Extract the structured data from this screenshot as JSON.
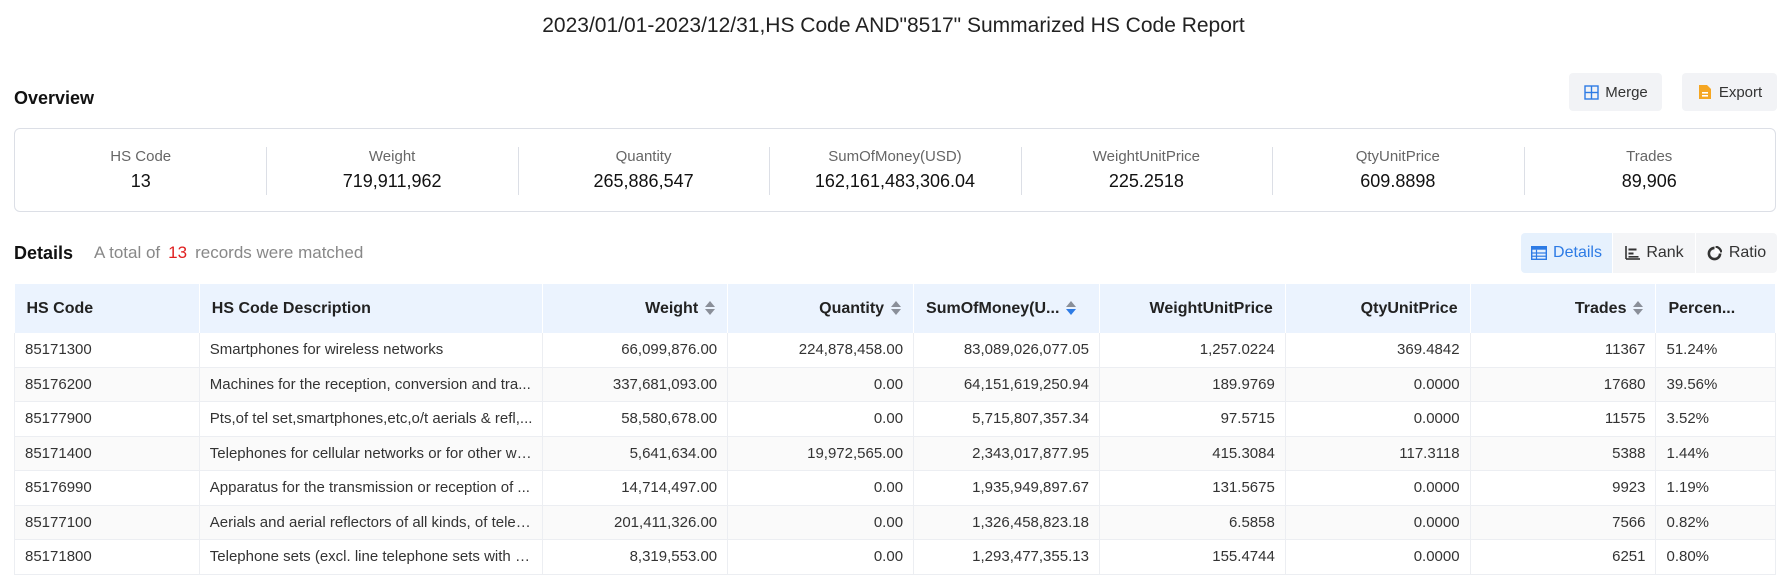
{
  "title": "2023/01/01-2023/12/31,HS Code AND\"8517\" Summarized HS Code Report",
  "overview": {
    "label": "Overview",
    "merge_label": "Merge",
    "export_label": "Export",
    "stats": [
      {
        "label": "HS Code",
        "value": "13"
      },
      {
        "label": "Weight",
        "value": "719,911,962"
      },
      {
        "label": "Quantity",
        "value": "265,886,547"
      },
      {
        "label": "SumOfMoney(USD)",
        "value": "162,161,483,306.04"
      },
      {
        "label": "WeightUnitPrice",
        "value": "225.2518"
      },
      {
        "label": "QtyUnitPrice",
        "value": "609.8898"
      },
      {
        "label": "Trades",
        "value": "89,906"
      }
    ]
  },
  "details": {
    "label": "Details",
    "records_prefix": "A total of",
    "records_count": "13",
    "records_suffix": "records were matched",
    "views": {
      "details": "Details",
      "rank": "Rank",
      "ratio": "Ratio"
    }
  },
  "table": {
    "headers": [
      "HS Code",
      "HS Code Description",
      "Weight",
      "Quantity",
      "SumOfMoney(U...",
      "WeightUnitPrice",
      "QtyUnitPrice",
      "Trades",
      "Percen..."
    ],
    "rows": [
      [
        "85171300",
        "Smartphones for wireless networks",
        "66,099,876.00",
        "224,878,458.00",
        "83,089,026,077.05",
        "1,257.0224",
        "369.4842",
        "11367",
        "51.24%"
      ],
      [
        "85176200",
        "Machines for the reception, conversion and tra...",
        "337,681,093.00",
        "0.00",
        "64,151,619,250.94",
        "189.9769",
        "0.0000",
        "17680",
        "39.56%"
      ],
      [
        "85177900",
        "Pts,of tel set,smartphones,etc,o/t aerials & refl,...",
        "58,580,678.00",
        "0.00",
        "5,715,807,357.34",
        "97.5715",
        "0.0000",
        "11575",
        "3.52%"
      ],
      [
        "85171400",
        "Telephones for cellular networks or for other wi...",
        "5,641,634.00",
        "19,972,565.00",
        "2,343,017,877.95",
        "415.3084",
        "117.3118",
        "5388",
        "1.44%"
      ],
      [
        "85176990",
        "Apparatus for the transmission or reception of ...",
        "14,714,497.00",
        "0.00",
        "1,935,949,897.67",
        "131.5675",
        "0.0000",
        "9923",
        "1.19%"
      ],
      [
        "85177100",
        "Aerials and aerial reflectors of all kinds, of telep...",
        "201,411,326.00",
        "0.00",
        "1,326,458,823.18",
        "6.5858",
        "0.0000",
        "7566",
        "0.82%"
      ],
      [
        "85171800",
        "Telephone sets (excl. line telephone sets with c...",
        "8,319,553.00",
        "0.00",
        "1,293,477,355.13",
        "155.4744",
        "0.0000",
        "6251",
        "0.80%"
      ]
    ]
  },
  "colors": {
    "accent": "#2d7be5",
    "header_bg": "#ebf3fe",
    "count_red": "#e02020",
    "export_icon": "#f5a623"
  }
}
